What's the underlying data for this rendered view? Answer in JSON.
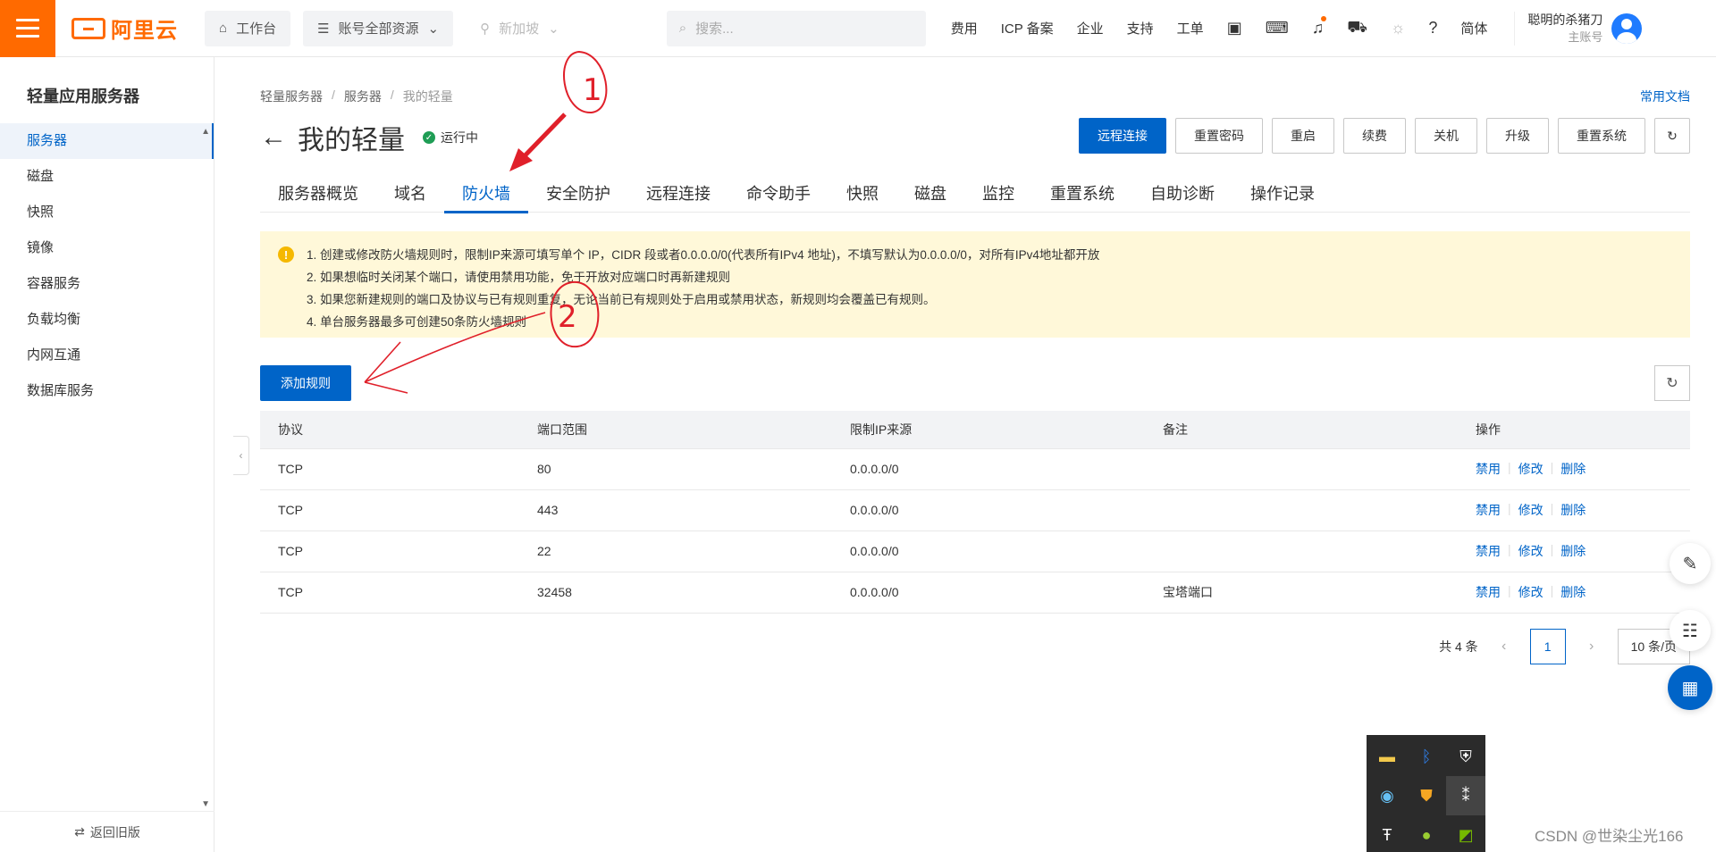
{
  "topbar": {
    "logo_text": "阿里云",
    "workbench": "工作台",
    "resources": "账号全部资源",
    "region": "新加坡",
    "search_placeholder": "搜索...",
    "links": [
      "费用",
      "ICP 备案",
      "企业",
      "支持",
      "工单"
    ],
    "lang": "简体",
    "account_name": "聪明的杀猪刀",
    "account_sub": "主账号"
  },
  "sidebar": {
    "title": "轻量应用服务器",
    "items": [
      {
        "label": "服务器",
        "active": true
      },
      {
        "label": "磁盘"
      },
      {
        "label": "快照"
      },
      {
        "label": "镜像"
      },
      {
        "label": "容器服务"
      },
      {
        "label": "负载均衡"
      },
      {
        "label": "内网互通"
      },
      {
        "label": "数据库服务"
      }
    ],
    "footer": "返回旧版"
  },
  "breadcrumb": [
    "轻量服务器",
    "服务器",
    "我的轻量"
  ],
  "doc_link": "常用文档",
  "page_title": "我的轻量",
  "status": "运行中",
  "actions": [
    "远程连接",
    "重置密码",
    "重启",
    "续费",
    "关机",
    "升级",
    "重置系统"
  ],
  "tabs": [
    "服务器概览",
    "域名",
    "防火墙",
    "安全防护",
    "远程连接",
    "命令助手",
    "快照",
    "磁盘",
    "监控",
    "重置系统",
    "自助诊断",
    "操作记录"
  ],
  "active_tab": "防火墙",
  "notice": [
    "1. 创建或修改防火墙规则时，限制IP来源可填写单个 IP，CIDR 段或者0.0.0.0/0(代表所有IPv4 地址)，不填写默认为0.0.0.0/0，对所有IPv4地址都开放",
    "2. 如果想临时关闭某个端口，请使用禁用功能，免于开放对应端口时再新建规则",
    "3. 如果您新建规则的端口及协议与已有规则重复，无论当前已有规则处于启用或禁用状态，新规则均会覆盖已有规则。",
    "4. 单台服务器最多可创建50条防火墙规则"
  ],
  "add_rule": "添加规则",
  "table": {
    "headers": [
      "协议",
      "端口范围",
      "限制IP来源",
      "备注",
      "操作"
    ],
    "rows": [
      {
        "protocol": "TCP",
        "port": "80",
        "source": "0.0.0.0/0",
        "note": ""
      },
      {
        "protocol": "TCP",
        "port": "443",
        "source": "0.0.0.0/0",
        "note": ""
      },
      {
        "protocol": "TCP",
        "port": "22",
        "source": "0.0.0.0/0",
        "note": ""
      },
      {
        "protocol": "TCP",
        "port": "32458",
        "source": "0.0.0.0/0",
        "note": "宝塔端口"
      }
    ],
    "ops": [
      "禁用",
      "修改",
      "删除"
    ]
  },
  "pagination": {
    "total": "共 4 条",
    "page": "1",
    "page_size": "10 条/页"
  },
  "annotations": {
    "mark1": "1",
    "mark2": "2"
  },
  "watermark": "CSDN @世染尘光166",
  "colors": {
    "brand": "#ff6a00",
    "primary": "#0064c8",
    "notice_bg": "#fff8d9",
    "annotation": "#e0202a"
  }
}
